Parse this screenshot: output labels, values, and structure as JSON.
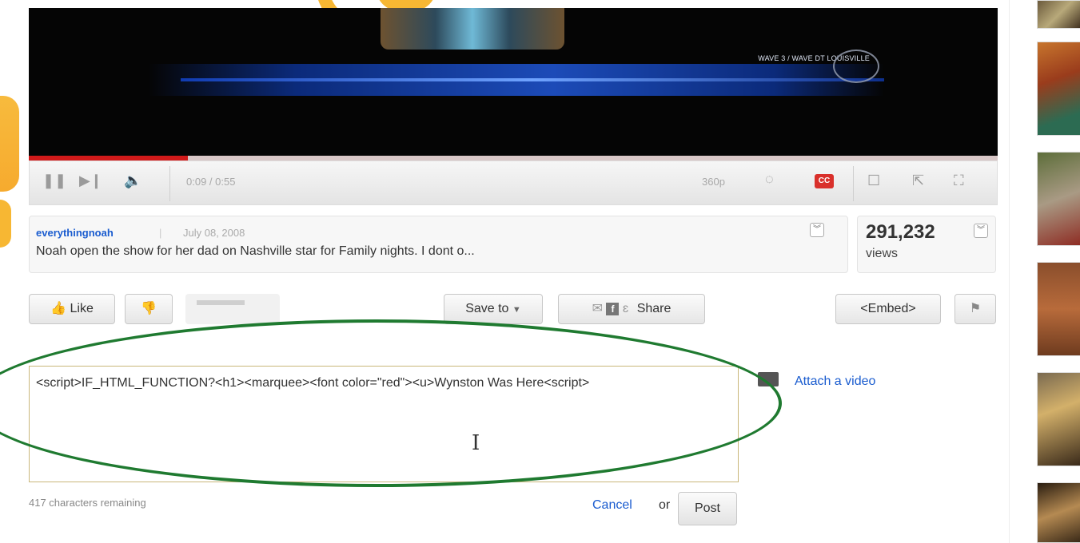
{
  "video": {
    "watermark": "WAVE 3 / WAVE DT LOUISVILLE",
    "progress_fraction": 0.164
  },
  "player": {
    "time": "0:09 / 0:55",
    "quality": "360p",
    "cc_label": "CC"
  },
  "info": {
    "author": "everythingnoah",
    "separator": "|",
    "date": "July 08, 2008",
    "description": "Noah open the show for her dad on Nashville star for Family nights. I dont o...",
    "views_count": "291,232",
    "views_label": "views"
  },
  "actions": {
    "like_label": "Like",
    "save_label": "Save to",
    "share_label": "Share",
    "embed_label": "<Embed>"
  },
  "comment": {
    "text": "<script>IF_HTML_FUNCTION?<h1><marquee><font color=\"red\"><u>Wynston Was Here<script>",
    "attach_label": "Attach a video",
    "remaining": "417 characters remaining",
    "cancel_label": "Cancel",
    "or_label": "or",
    "post_label": "Post"
  },
  "colors": {
    "link": "#1a5ccf",
    "progress": "#d11a1a",
    "annotation": "#1f7a30",
    "accent": "#f7b733"
  }
}
